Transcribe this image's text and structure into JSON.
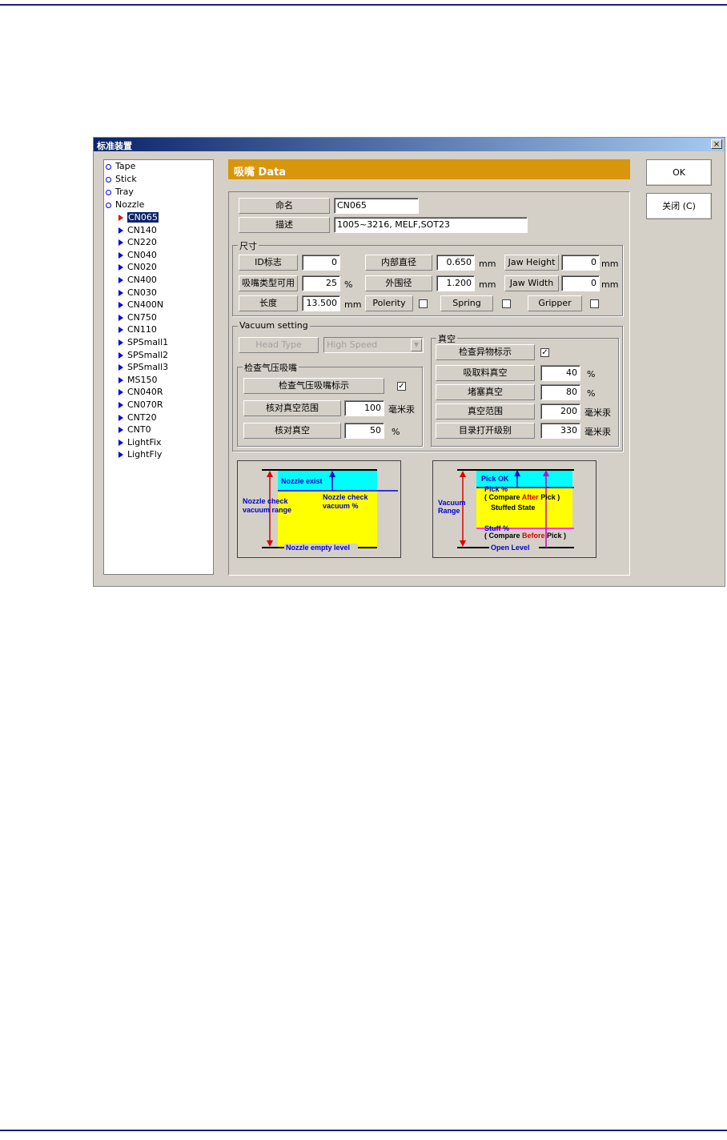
{
  "window": {
    "title": "标准装置",
    "close_glyph": "×"
  },
  "tree": {
    "categories": [
      "Tape",
      "Stick",
      "Tray",
      "Nozzle"
    ],
    "selected": "CN065",
    "nozzles": [
      "CN065",
      "CN140",
      "CN220",
      "CN040",
      "CN020",
      "CN400",
      "CN030",
      "CN400N",
      "CN750",
      "CN110",
      "SPSmall1",
      "SPSmall2",
      "SPSmall3",
      "MS150",
      "CN040R",
      "CN070R",
      "CNT20",
      "CNT0",
      "LightFix",
      "LightFly"
    ]
  },
  "header": {
    "title": "吸嘴 Data"
  },
  "buttons": {
    "ok": "OK",
    "close": "关闭 (C)"
  },
  "identity": {
    "name_label": "命名",
    "name_value": "CN065",
    "desc_label": "描述",
    "desc_value": "1005~3216, MELF,SOT23"
  },
  "size": {
    "group_title": "尺寸",
    "id_label": "ID标志",
    "id_value": "0",
    "inner_label": "内部直径",
    "inner_value": "0.650",
    "inner_unit": "mm",
    "jaw_height_label": "Jaw Height",
    "jaw_height_value": "0",
    "jaw_height_unit": "mm",
    "type_label": "吸嘴类型可用",
    "type_value": "25",
    "type_unit": "%",
    "outer_label": "外围径",
    "outer_value": "1.200",
    "outer_unit": "mm",
    "jaw_width_label": "Jaw Width",
    "jaw_width_value": "0",
    "jaw_width_unit": "mm",
    "length_label": "长度",
    "length_value": "13.500",
    "length_unit": "mm",
    "polarity_label": "Polerity",
    "spring_label": "Spring",
    "gripper_label": "Gripper"
  },
  "vacuum": {
    "group_title": "Vacuum setting",
    "head_type_label": "Head Type",
    "head_type_value": "High Speed",
    "check_group_title": "检查气压吸嘴",
    "check_flag_label": "检查气压吸嘴标示",
    "check_flag_checked": true,
    "check_range_label": "核对真空范围",
    "check_range_value": "100",
    "check_range_unit": "毫米汞",
    "check_vac_label": "核对真空",
    "check_vac_value": "50",
    "check_vac_unit": "%",
    "vac_group_title": "真空",
    "foreign_label": "检查异物标示",
    "foreign_checked": true,
    "pick_label": "吸取料真空",
    "pick_value": "40",
    "pick_unit": "%",
    "stuff_label": "堵塞真空",
    "stuff_value": "80",
    "stuff_unit": "%",
    "range_label": "真空范围",
    "range_value": "200",
    "range_unit": "毫米汞",
    "open_label": "目录打开级别",
    "open_value": "330",
    "open_unit": "毫米汞"
  },
  "diagram_left": {
    "exist": "Nozzle exist",
    "range": [
      "Nozzle check",
      "vacuum range"
    ],
    "pct": [
      "Nozzle check",
      "vacuum %"
    ],
    "empty": "Nozzle empty level"
  },
  "diagram_right": {
    "pick_ok": "Pick OK",
    "pick_pct": "Pick %",
    "cmp_after": [
      "( Compare ",
      "After",
      " Pick )"
    ],
    "stuffed": "Stuffed State",
    "stuff_pct": "Stuff %",
    "cmp_before": [
      "( Compare ",
      "Before",
      " Pick )"
    ],
    "range": [
      "Vacuum",
      "Range"
    ],
    "open": "Open Level"
  },
  "colors": {
    "header": "#d8960c",
    "cyan": "#00ffff",
    "yellow": "#ffff00",
    "blue": "#0000cc",
    "red": "#dd0000",
    "magenta": "#ff00ff"
  }
}
